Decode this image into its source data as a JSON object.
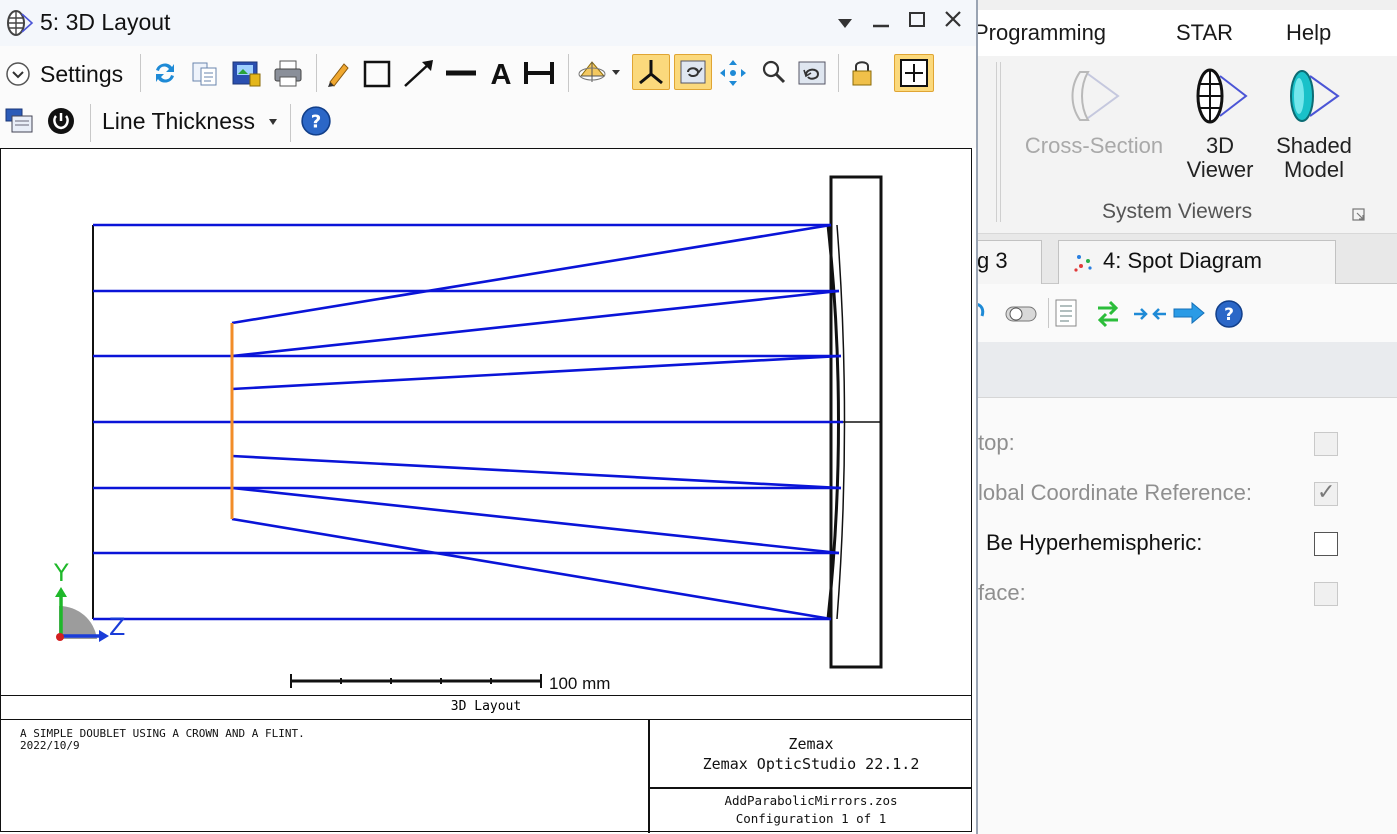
{
  "background_app": {
    "menu": [
      "Programming",
      "STAR",
      "Help"
    ],
    "ribbon": {
      "buttons": [
        {
          "label": "Cross-Section",
          "enabled": false,
          "icon": "cross-section-lens-icon"
        },
        {
          "label": "3D Viewer",
          "line1": "3D",
          "line2": "Viewer",
          "icon": "3d-viewer-icon"
        },
        {
          "label": "Shaded Model",
          "line1": "Shaded",
          "line2": "Model",
          "icon": "shaded-model-icon"
        }
      ],
      "group_label": "System Viewers"
    },
    "tabs": [
      {
        "label": "g 3"
      },
      {
        "label": "4: Spot Diagram",
        "icon": "spot-diagram-icon"
      }
    ],
    "options": [
      {
        "label": "top:",
        "checked": false,
        "enabled": false
      },
      {
        "label": "lobal Coordinate Reference:",
        "checked": true,
        "enabled": false
      },
      {
        "label": "Be Hyperhemispheric:",
        "checked": false,
        "enabled": true
      },
      {
        "label": "face:",
        "checked": false,
        "enabled": false
      }
    ]
  },
  "window": {
    "title": "5: 3D Layout",
    "toolbar": {
      "settings_label": "Settings",
      "line_thickness_label": "Line Thickness"
    },
    "plot": {
      "scale_bar_label": "100 mm",
      "axis_y_label": "Y",
      "axis_z_label": "Z",
      "caption": "3D Layout"
    },
    "footer": {
      "description_line1": "A SIMPLE DOUBLET USING A CROWN AND A FLINT.",
      "description_line2": "2022/10/9",
      "company": "Zemax",
      "product": "Zemax OpticStudio 22.1.2",
      "file": "AddParabolicMirrors.zos",
      "configuration": "Configuration 1 of 1"
    }
  },
  "colors": {
    "ray": "#0a14d8",
    "secondary_mirror": "#f28c28",
    "active_toolbar": "#fbd97c",
    "axis_y": "#1fb82a",
    "axis_z": "#1a3cd8"
  }
}
